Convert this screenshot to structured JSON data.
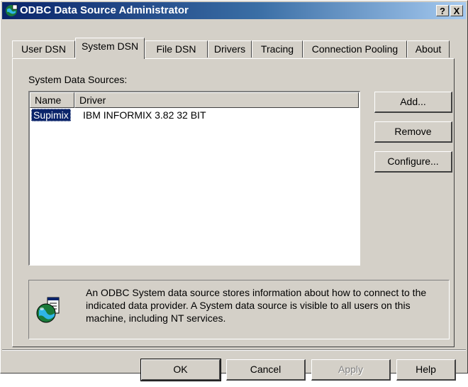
{
  "window": {
    "title": "ODBC Data Source Administrator",
    "help_button": "?",
    "close_button": "X"
  },
  "tabs": [
    {
      "label": "User DSN"
    },
    {
      "label": "System DSN"
    },
    {
      "label": "File DSN"
    },
    {
      "label": "Drivers"
    },
    {
      "label": "Tracing"
    },
    {
      "label": "Connection Pooling"
    },
    {
      "label": "About"
    }
  ],
  "active_tab": "System DSN",
  "system_dsn": {
    "list_label": "System Data Sources:",
    "columns": [
      "Name",
      "Driver"
    ],
    "rows": [
      {
        "name": "Supimix",
        "driver": "IBM INFORMIX 3.82 32 BIT"
      }
    ],
    "buttons": {
      "add": "Add...",
      "remove": "Remove",
      "configure": "Configure..."
    },
    "info_text": "An ODBC System data source stores information about how to connect to the indicated data provider.   A System data source is visible to all users on this machine, including NT services."
  },
  "footer": {
    "ok": "OK",
    "cancel": "Cancel",
    "apply": "Apply",
    "help": "Help"
  },
  "colors": {
    "titlebar_start": "#0a246a",
    "titlebar_end": "#a6caf0",
    "face": "#d4d0c8",
    "selection": "#0a246a"
  },
  "icons": {
    "app": "globe-database-icon",
    "info": "globe-database-icon"
  }
}
